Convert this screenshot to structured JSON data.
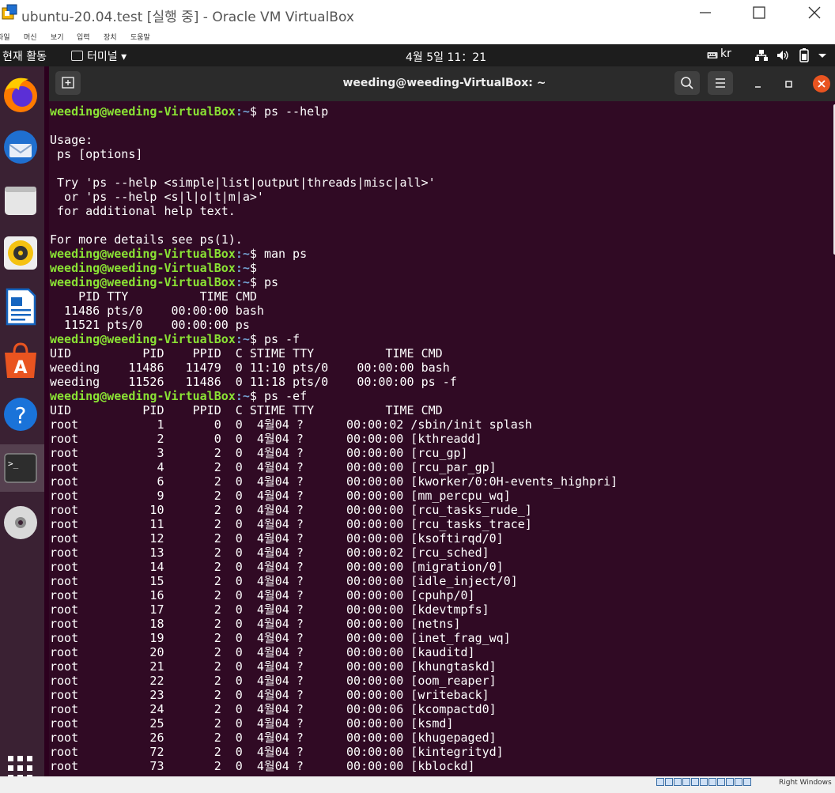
{
  "window": {
    "title": "ubuntu-20.04.test [실행 중] - Oracle VM VirtualBox",
    "menu": [
      "파일",
      "머신",
      "보기",
      "입력",
      "장치",
      "도움말"
    ]
  },
  "ubuntu_topbar": {
    "activities": "현재 활동",
    "app_menu": "터미널",
    "clock": "4월 5일  11：21",
    "keyboard_layout": "kr"
  },
  "dock": {
    "items": [
      "firefox",
      "thunderbird",
      "files",
      "rhythmbox",
      "libreoffice-writer",
      "ubuntu-software",
      "help",
      "terminal",
      "dvd"
    ]
  },
  "terminal": {
    "title": "weeding@weeding-VirtualBox: ~",
    "prompt_user": "weeding@weeding-VirtualBox",
    "prompt_path": ":~",
    "lines": [
      {
        "type": "prompt",
        "cmd": "ps --help"
      },
      {
        "type": "text",
        "text": ""
      },
      {
        "type": "text",
        "text": "Usage:"
      },
      {
        "type": "text",
        "text": " ps [options]"
      },
      {
        "type": "text",
        "text": ""
      },
      {
        "type": "text",
        "text": " Try 'ps --help <simple|list|output|threads|misc|all>'"
      },
      {
        "type": "text",
        "text": "  or 'ps --help <s|l|o|t|m|a>'"
      },
      {
        "type": "text",
        "text": " for additional help text."
      },
      {
        "type": "text",
        "text": ""
      },
      {
        "type": "text",
        "text": "For more details see ps(1)."
      },
      {
        "type": "prompt",
        "cmd": "man ps"
      },
      {
        "type": "prompt",
        "cmd": ""
      },
      {
        "type": "prompt",
        "cmd": "ps"
      },
      {
        "type": "text",
        "text": "    PID TTY          TIME CMD"
      },
      {
        "type": "text",
        "text": "  11486 pts/0    00:00:00 bash"
      },
      {
        "type": "text",
        "text": "  11521 pts/0    00:00:00 ps"
      },
      {
        "type": "prompt",
        "cmd": "ps -f"
      },
      {
        "type": "text",
        "text": "UID          PID    PPID  C STIME TTY          TIME CMD"
      },
      {
        "type": "text",
        "text": "weeding    11486   11479  0 11:10 pts/0    00:00:00 bash"
      },
      {
        "type": "text",
        "text": "weeding    11526   11486  0 11:18 pts/0    00:00:00 ps -f"
      },
      {
        "type": "prompt",
        "cmd": "ps -ef"
      },
      {
        "type": "text",
        "text": "UID          PID    PPID  C STIME TTY          TIME CMD"
      },
      {
        "type": "text",
        "text": "root           1       0  0  4월04 ?      00:00:02 /sbin/init splash"
      },
      {
        "type": "text",
        "text": "root           2       0  0  4월04 ?      00:00:00 [kthreadd]"
      },
      {
        "type": "text",
        "text": "root           3       2  0  4월04 ?      00:00:00 [rcu_gp]"
      },
      {
        "type": "text",
        "text": "root           4       2  0  4월04 ?      00:00:00 [rcu_par_gp]"
      },
      {
        "type": "text",
        "text": "root           6       2  0  4월04 ?      00:00:00 [kworker/0:0H-events_highpri]"
      },
      {
        "type": "text",
        "text": "root           9       2  0  4월04 ?      00:00:00 [mm_percpu_wq]"
      },
      {
        "type": "text",
        "text": "root          10       2  0  4월04 ?      00:00:00 [rcu_tasks_rude_]"
      },
      {
        "type": "text",
        "text": "root          11       2  0  4월04 ?      00:00:00 [rcu_tasks_trace]"
      },
      {
        "type": "text",
        "text": "root          12       2  0  4월04 ?      00:00:00 [ksoftirqd/0]"
      },
      {
        "type": "text",
        "text": "root          13       2  0  4월04 ?      00:00:02 [rcu_sched]"
      },
      {
        "type": "text",
        "text": "root          14       2  0  4월04 ?      00:00:00 [migration/0]"
      },
      {
        "type": "text",
        "text": "root          15       2  0  4월04 ?      00:00:00 [idle_inject/0]"
      },
      {
        "type": "text",
        "text": "root          16       2  0  4월04 ?      00:00:00 [cpuhp/0]"
      },
      {
        "type": "text",
        "text": "root          17       2  0  4월04 ?      00:00:00 [kdevtmpfs]"
      },
      {
        "type": "text",
        "text": "root          18       2  0  4월04 ?      00:00:00 [netns]"
      },
      {
        "type": "text",
        "text": "root          19       2  0  4월04 ?      00:00:00 [inet_frag_wq]"
      },
      {
        "type": "text",
        "text": "root          20       2  0  4월04 ?      00:00:00 [kauditd]"
      },
      {
        "type": "text",
        "text": "root          21       2  0  4월04 ?      00:00:00 [khungtaskd]"
      },
      {
        "type": "text",
        "text": "root          22       2  0  4월04 ?      00:00:00 [oom_reaper]"
      },
      {
        "type": "text",
        "text": "root          23       2  0  4월04 ?      00:00:00 [writeback]"
      },
      {
        "type": "text",
        "text": "root          24       2  0  4월04 ?      00:00:06 [kcompactd0]"
      },
      {
        "type": "text",
        "text": "root          25       2  0  4월04 ?      00:00:00 [ksmd]"
      },
      {
        "type": "text",
        "text": "root          26       2  0  4월04 ?      00:00:00 [khugepaged]"
      },
      {
        "type": "text",
        "text": "root          72       2  0  4월04 ?      00:00:00 [kintegrityd]"
      },
      {
        "type": "text",
        "text": "root          73       2  0  4월04 ?      00:00:00 [kblockd]"
      }
    ]
  },
  "statusbar": {
    "host_key": "Right Windows"
  },
  "colors": {
    "terminal_bg": "#300a24",
    "prompt_user": "#8ae234",
    "prompt_path": "#729fcf",
    "close_button": "#e95420"
  }
}
